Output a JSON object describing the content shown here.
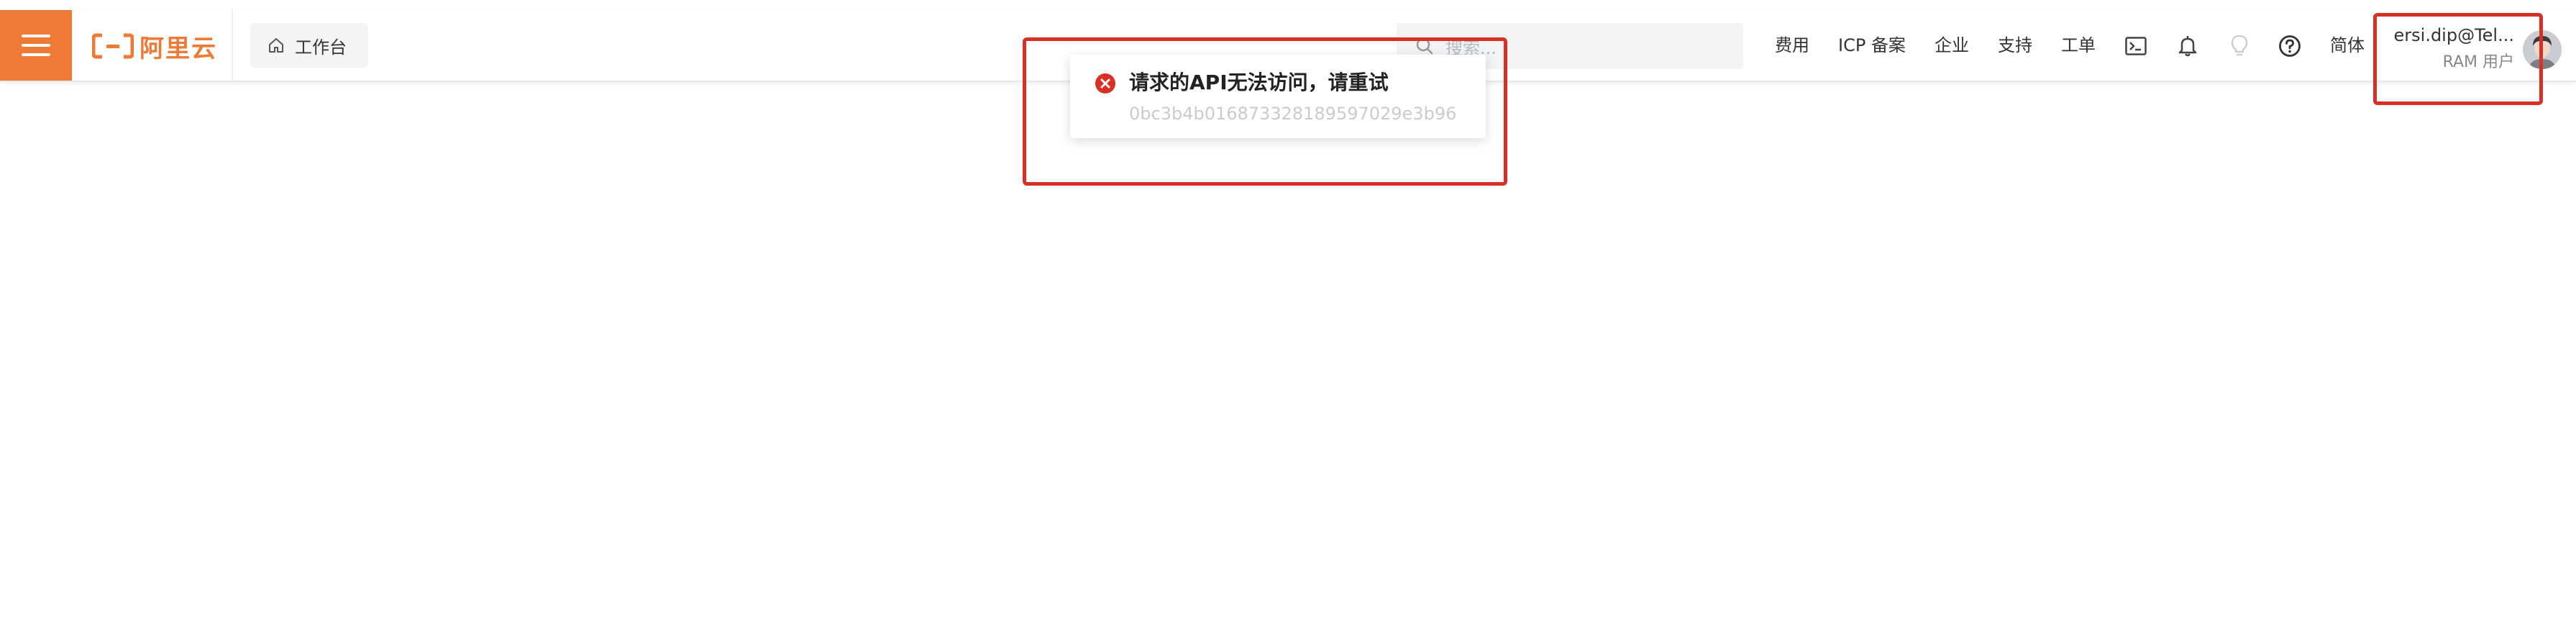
{
  "header": {
    "logo_text": "阿里云",
    "workbench_label": "工作台",
    "search_placeholder": "搜索...",
    "nav": {
      "fees": "费用",
      "icp": "ICP 备案",
      "enterprise": "企业",
      "support": "支持",
      "ticket": "工单",
      "language": "简体"
    },
    "user": {
      "name": "ersi.dip@Tel...",
      "role": "RAM 用户"
    }
  },
  "toast": {
    "message": "请求的API无法访问，请重试",
    "request_id": "0bc3b4b016873328189597029e3b96"
  },
  "colors": {
    "brand": "#ee7a35",
    "error": "#d93025",
    "highlight": "#d93025"
  }
}
